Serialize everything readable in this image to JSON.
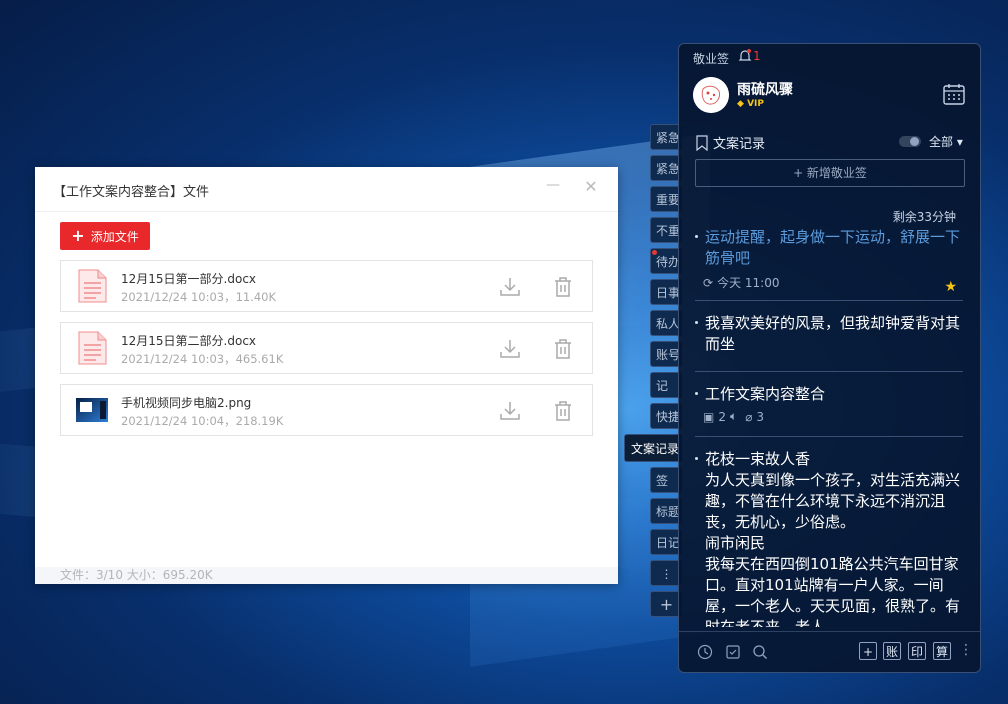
{
  "dialog": {
    "title": "【工作文案内容整合】文件",
    "minimize_glyph": "—",
    "close_glyph": "✕",
    "add_button_label": "添加文件",
    "files": [
      {
        "name": "12月15日第一部分.docx",
        "meta": "2021/12/24 10:03，11.40K",
        "icon": "docx-file-icon"
      },
      {
        "name": "12月15日第二部分.docx",
        "meta": "2021/12/24 10:03，465.61K",
        "icon": "docx-file-icon"
      },
      {
        "name": "手机视频同步电脑2.png",
        "meta": "2021/12/24 10:04，218.19K",
        "icon": "image-thumbnail"
      }
    ],
    "footer": "文件：3/10   大小：695.20K"
  },
  "side_tabs": [
    {
      "label": "紧急"
    },
    {
      "label": "紧急"
    },
    {
      "label": "重要"
    },
    {
      "label": "不重"
    },
    {
      "label": "待办",
      "dot": true
    },
    {
      "label": "日事"
    },
    {
      "label": "私人"
    },
    {
      "label": "账号"
    },
    {
      "label": "记"
    },
    {
      "label": "快捷"
    },
    {
      "label": "文案记录",
      "active": true
    },
    {
      "label": "签"
    },
    {
      "label": "标题"
    },
    {
      "label": "日记"
    },
    {
      "label": "⋮"
    },
    {
      "label": "+"
    }
  ],
  "panel": {
    "brand": "敬业签",
    "bell_count": "1",
    "username": "雨硫风骤",
    "vip": "VIP",
    "section_title": "文案记录",
    "filter_label": "全部",
    "new_note_label": "+ 新增敬业签",
    "remaining": "剩余33分钟",
    "notes": [
      {
        "text": "运动提醒，起身做一下运动，舒展一下筋骨吧",
        "meta": "今天 11:00"
      },
      {
        "text": "我喜欢美好的风景，但我却钟爱背对其而坐"
      },
      {
        "text": "工作文案内容整合",
        "images": "2",
        "audio": "",
        "attachments": "3"
      }
    ],
    "long_note": "花枝一束故人香\n为人天真到像一个孩子，对生活充满兴趣，不管在什么环境下永远不消沉沮丧，无机心，少俗虑。\n闹市闲民\n我每天在西四倒101路公共汽车回甘家口。直对101站牌有一户人家。一间屋，一个老人。天天见面，很熟了。有时在老不来，老人",
    "footer_buttons": [
      "账",
      "印",
      "算"
    ]
  },
  "colors": {
    "accent_red": "#e8282b",
    "panel_bg": "#061630",
    "reminder_blue": "#5b9bdc",
    "star_yellow": "#f5c518"
  }
}
